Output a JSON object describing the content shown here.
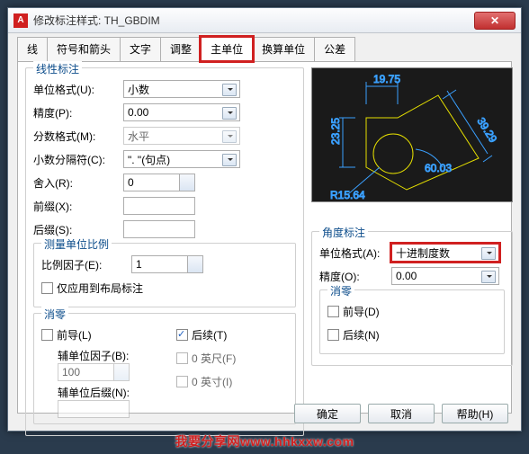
{
  "title": "修改标注样式: TH_GBDIM",
  "tabs": [
    "线",
    "符号和箭头",
    "文字",
    "调整",
    "主单位",
    "换算单位",
    "公差"
  ],
  "linear": {
    "legend": "线性标注",
    "unit_format_label": "单位格式(U):",
    "unit_format_value": "小数",
    "precision_label": "精度(P):",
    "precision_value": "0.00",
    "fraction_format_label": "分数格式(M):",
    "fraction_format_value": "水平",
    "decimal_sep_label": "小数分隔符(C):",
    "decimal_sep_value": "\". \"(句点)",
    "roundoff_label": "舍入(R):",
    "roundoff_value": "0",
    "prefix_label": "前缀(X):",
    "prefix_value": "",
    "suffix_label": "后缀(S):",
    "suffix_value": ""
  },
  "scale": {
    "legend": "测量单位比例",
    "factor_label": "比例因子(E):",
    "factor_value": "1",
    "layout_only_label": "仅应用到布局标注"
  },
  "zeroSuppress": {
    "legend": "消零",
    "leading_label": "前导(L)",
    "trailing_label": "后续(T)",
    "subunit_factor_label": "辅单位因子(B):",
    "subunit_factor_value": "100",
    "subunit_suffix_label": "辅单位后缀(N):",
    "subunit_suffix_value": "",
    "feet_label": "0 英尺(F)",
    "inches_label": "0 英寸(I)"
  },
  "angular": {
    "legend": "角度标注",
    "unit_format_label": "单位格式(A):",
    "unit_format_value": "十进制度数",
    "precision_label": "精度(O):",
    "precision_value": "0.00",
    "zero_legend": "消零",
    "leading_label": "前导(D)",
    "trailing_label": "后续(N)"
  },
  "preview_dims": {
    "top": "19.75",
    "left": "23.25",
    "radius": "R15.64",
    "diag": "39.29",
    "ang": "60.03"
  },
  "buttons": {
    "ok": "确定",
    "cancel": "取消",
    "help": "帮助(H)"
  },
  "watermark": "我要分享网www.hhkxxw.com"
}
